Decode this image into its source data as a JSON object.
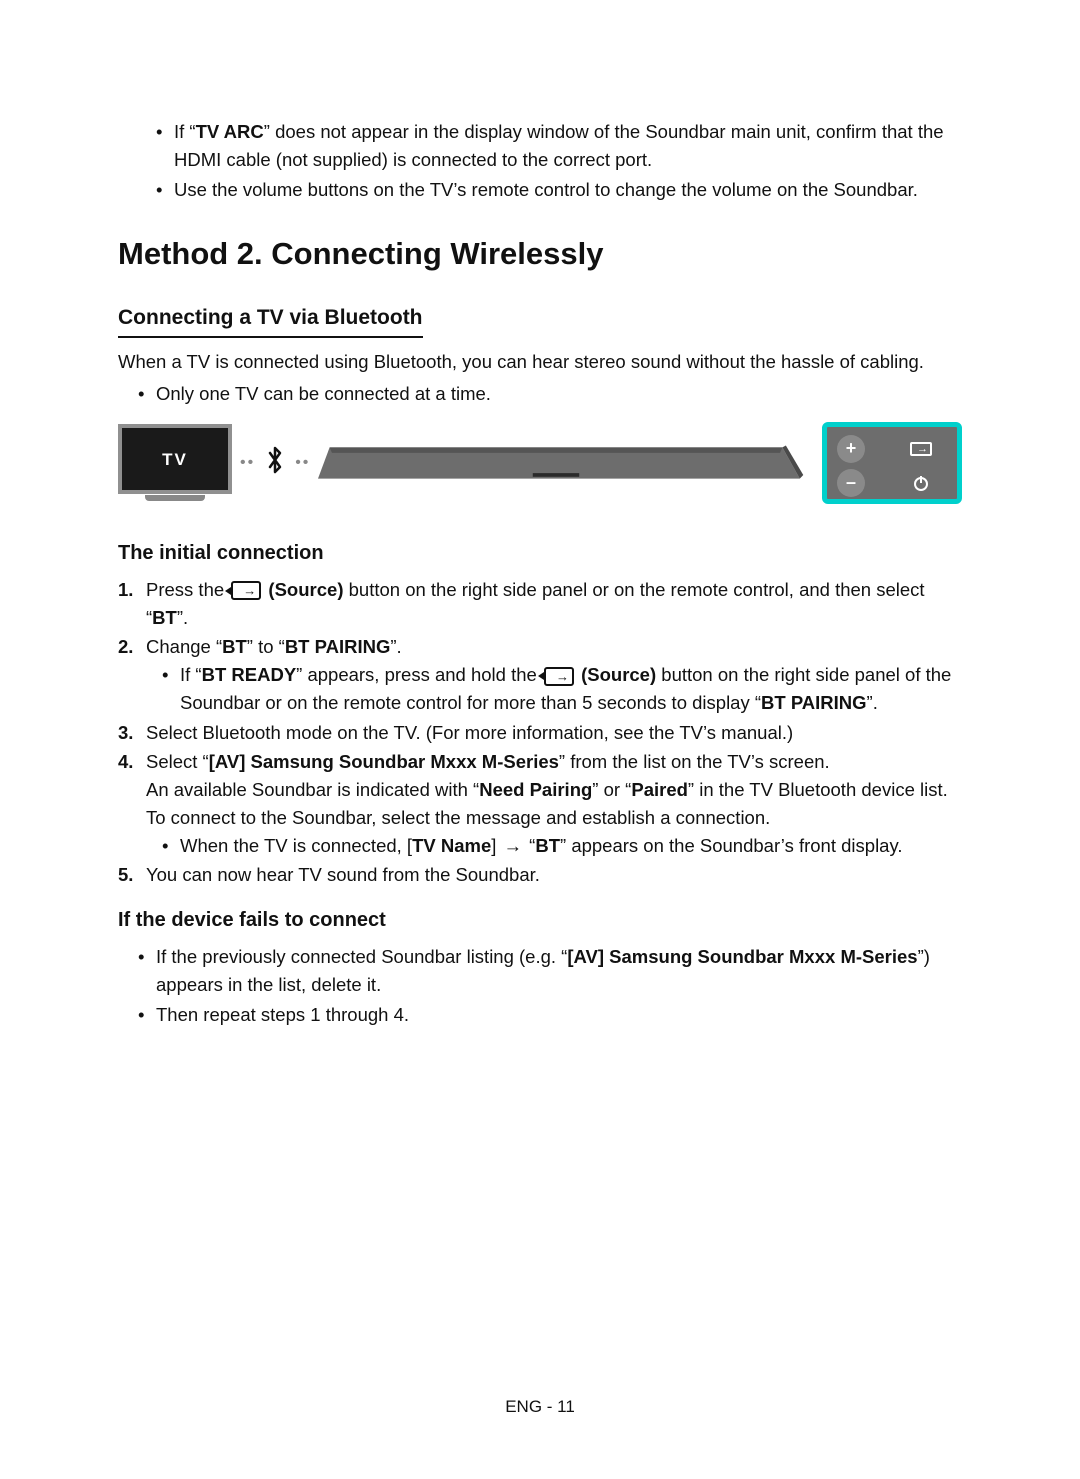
{
  "pre_bullets": [
    {
      "prefix": "If “",
      "bold": "TV ARC",
      "suffix": "” does not appear in the display window of the Soundbar main unit, confirm that the HDMI cable (not supplied) is connected to the correct port."
    },
    {
      "text": "Use the volume buttons on the TV’s remote control to change the volume on the Soundbar."
    }
  ],
  "section_title": "Method 2. Connecting Wirelessly",
  "subsection": "Connecting a TV via Bluetooth",
  "intro": "When a TV is connected using Bluetooth, you can hear stereo sound without the hassle of cabling.",
  "intro_bullet": "Only one TV can be connected at a time.",
  "diagram": {
    "tv_label": "TV",
    "panel": {
      "plus": "+",
      "minus": "–",
      "source_title": "Source",
      "power_title": "Power"
    }
  },
  "initial": {
    "heading": "The initial connection",
    "step1": {
      "a": "Press the ",
      "b": " (Source)",
      "c": " button on the right side panel or on the remote control, and then select “",
      "bt": "BT",
      "d": "”."
    },
    "step2": {
      "a": "Change “",
      "bt": "BT",
      "b": "” to “",
      "pair": "BT PAIRING",
      "c": "”."
    },
    "step2_sub": {
      "a": "If “",
      "ready": "BT READY",
      "b": "” appears, press and hold the ",
      "src": " (Source)",
      "c": " button on the right side panel of the Soundbar or on the remote control for more than 5 seconds to display “",
      "pair": "BT PAIRING",
      "d": "”."
    },
    "step3": "Select Bluetooth mode on the TV. (For more information, see the TV’s manual.)",
    "step4": {
      "a": "Select “",
      "dev": "[AV] Samsung Soundbar Mxxx M-Series",
      "b": "” from the list on the TV’s screen.",
      "line2a": "An available Soundbar is indicated with “",
      "need": "Need Pairing",
      "line2b": "” or “",
      "paired": "Paired",
      "line2c": "” in the TV Bluetooth device list.",
      "line3": "To connect to the Soundbar, select the message and establish a connection.",
      "sub_a": "When the TV is connected, [",
      "tvname": "TV Name",
      "sub_b": "] ",
      "arrow": "→",
      "sub_c": " “",
      "bt": "BT",
      "sub_d": "” appears on the Soundbar’s front display."
    },
    "step5": "You can now hear TV sound from the Soundbar."
  },
  "fail": {
    "heading": "If the device fails to connect",
    "b1_a": "If the previously connected Soundbar listing (e.g. “",
    "b1_dev": "[AV] Samsung Soundbar Mxxx M-Series",
    "b1_b": "”) appears in the list, delete it.",
    "b2": "Then repeat steps 1 through 4."
  },
  "footer": "ENG - 11"
}
